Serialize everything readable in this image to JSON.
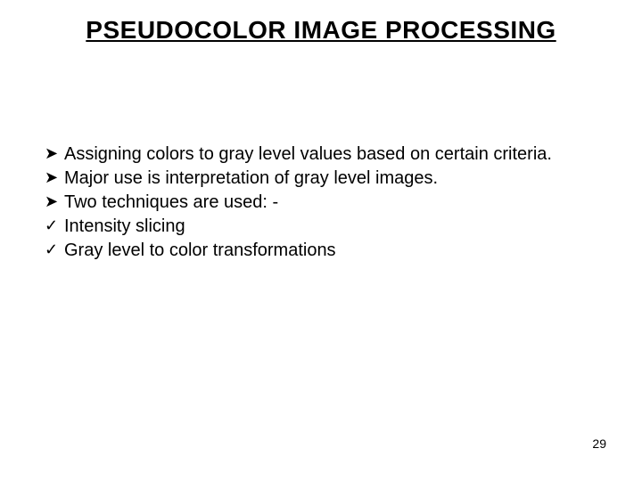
{
  "title": "PSEUDOCOLOR IMAGE PROCESSING",
  "items": [
    {
      "marker": "➤",
      "text": "Assigning colors to gray level values based on certain criteria."
    },
    {
      "marker": "➤",
      "text": "Major use is interpretation of gray level images."
    },
    {
      "marker": "➤",
      "text": "Two techniques are used: -"
    },
    {
      "marker": "✓",
      "text": "Intensity slicing"
    },
    {
      "marker": "✓",
      "text": "Gray level to color transformations"
    }
  ],
  "page_number": "29"
}
